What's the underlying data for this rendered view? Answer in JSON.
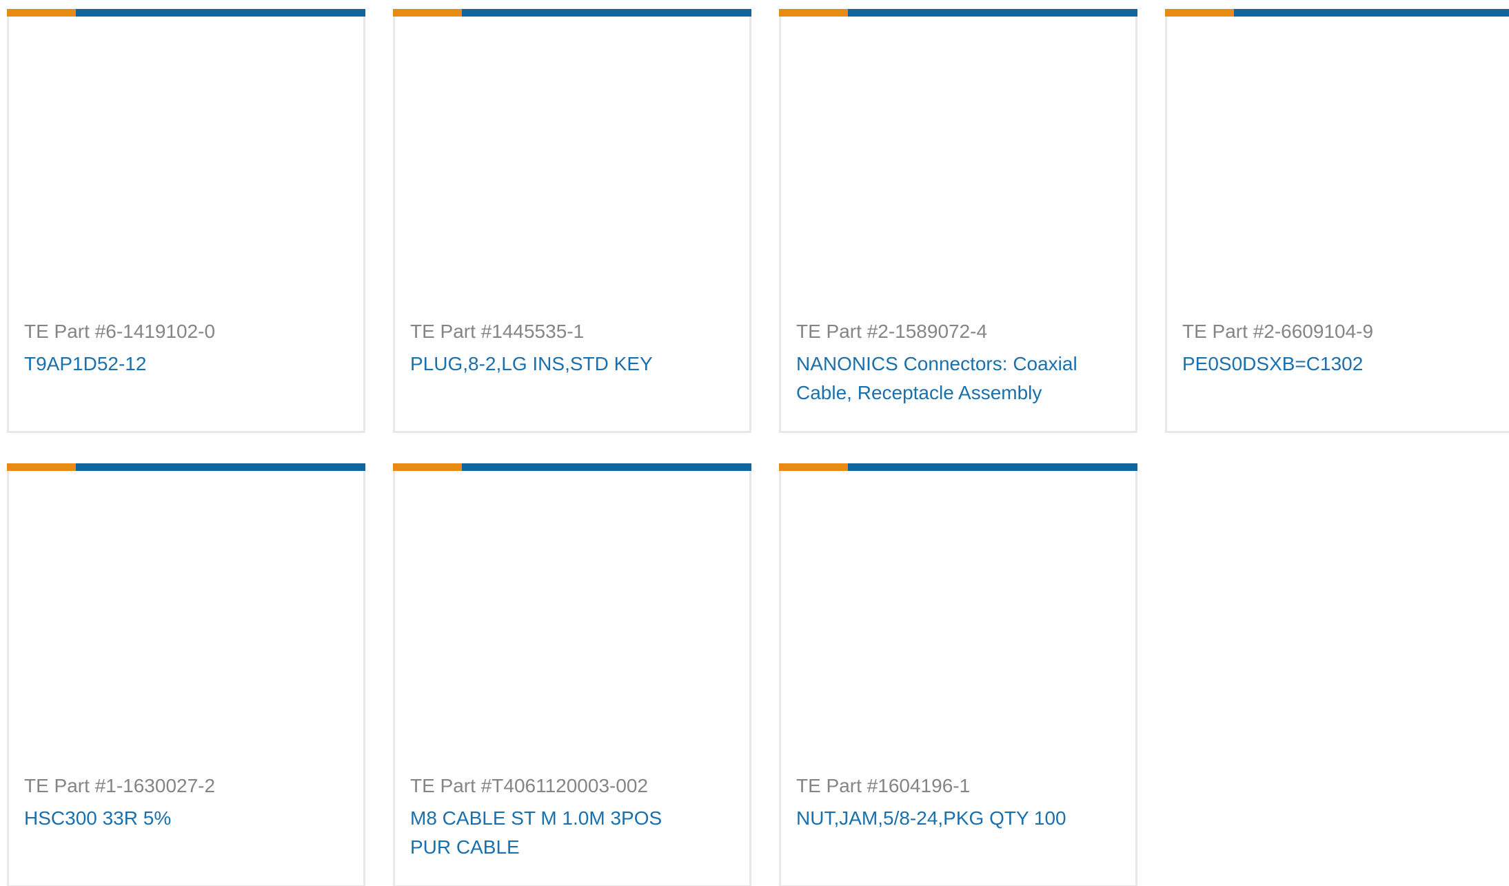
{
  "products": [
    {
      "part_number": "TE Part #6-1419102-0",
      "title": "T9AP1D52-12"
    },
    {
      "part_number": "TE Part #1445535-1",
      "title": "PLUG,8-2,LG INS,STD KEY"
    },
    {
      "part_number": "TE Part #2-1589072-4",
      "title": "NANONICS Connectors: Coaxial Cable, Receptacle Assembly"
    },
    {
      "part_number": "TE Part #2-6609104-9",
      "title": "PE0S0DSXB=C1302"
    },
    {
      "part_number": "TE Part #1-1630027-2",
      "title": "HSC300 33R 5%"
    },
    {
      "part_number": "TE Part #T4061120003-002",
      "title": "M8 CABLE ST M 1.0M 3POS PUR CABLE"
    },
    {
      "part_number": "TE Part #1604196-1",
      "title": "NUT,JAM,5/8-24,PKG QTY 100"
    }
  ],
  "colors": {
    "accent_orange": "#e88b12",
    "accent_blue": "#0e659f",
    "part_number_text": "#858585",
    "title_link": "#1a70ad",
    "card_border": "#e8e8e8"
  }
}
